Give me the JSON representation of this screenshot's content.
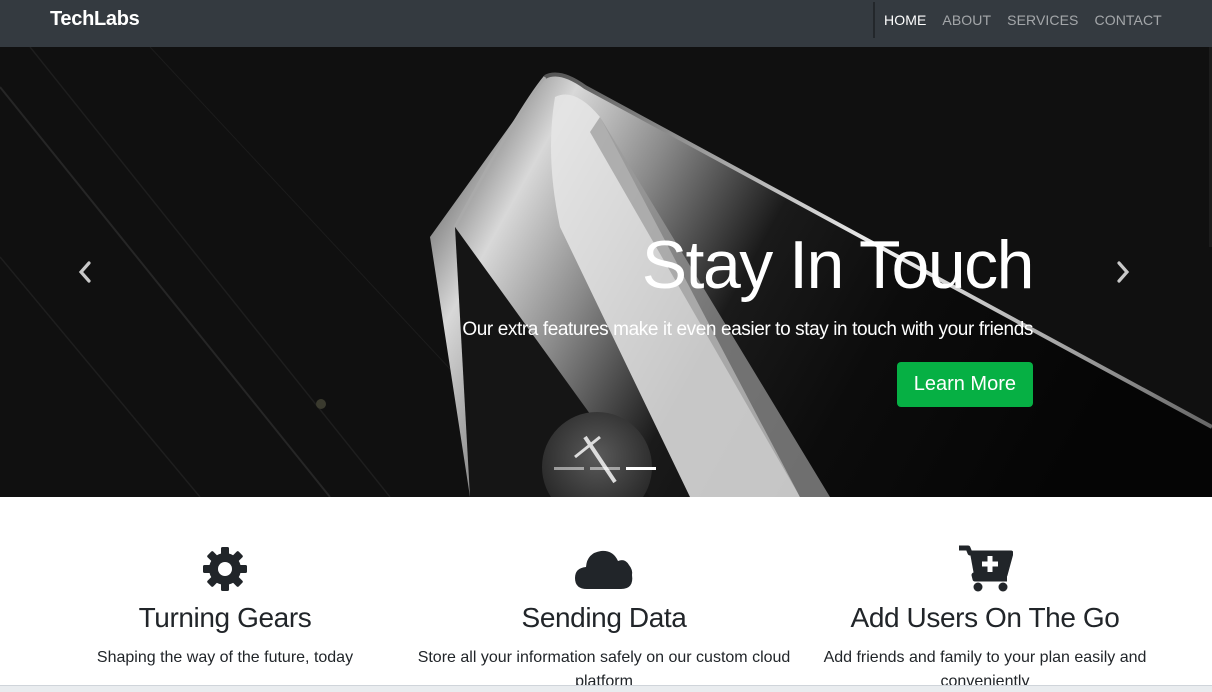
{
  "brand": "TechLabs",
  "nav": [
    {
      "label": "HOME",
      "active": true
    },
    {
      "label": "ABOUT",
      "active": false
    },
    {
      "label": "SERVICES",
      "active": false
    },
    {
      "label": "CONTACT",
      "active": false
    }
  ],
  "carousel": {
    "title": "Stay In Touch",
    "subtitle": "Our extra features make it even easier to stay in touch with your friends",
    "button_label": "Learn More",
    "prev_icon": "chevron-left-icon",
    "next_icon": "chevron-right-icon",
    "slide_count": 3,
    "active_slide": 3
  },
  "features": [
    {
      "icon": "gear-icon",
      "title": "Turning Gears",
      "text": "Shaping the way of the future, today"
    },
    {
      "icon": "cloud-icon",
      "title": "Sending Data",
      "text": "Store all your information safely on our custom cloud platform"
    },
    {
      "icon": "cart-plus-icon",
      "title": "Add Users On The Go",
      "text": "Add friends and family to your plan easily and conveniently"
    }
  ],
  "colors": {
    "navbar": "#343a40",
    "accent": "#06b044",
    "text": "#212529"
  }
}
